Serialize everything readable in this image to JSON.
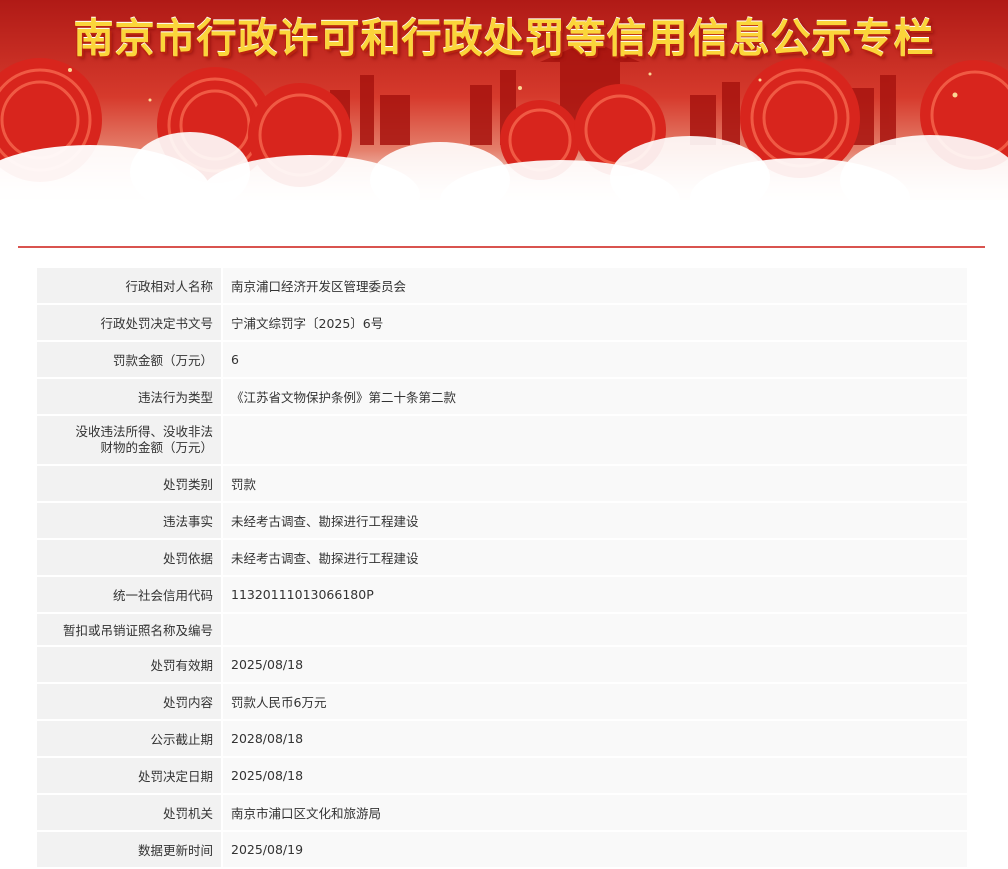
{
  "banner": {
    "title": "南京市行政许可和行政处罚等信用信息公示专栏"
  },
  "colors": {
    "banner_red": "#c8201a",
    "title_gold": "#fbd53a",
    "divider_red": "#d9534f",
    "label_bg": "#f2f2f2",
    "value_bg": "#f9f9f9"
  },
  "record": {
    "rows": [
      {
        "label": "行政相对人名称",
        "value": "南京浦口经济开发区管理委员会"
      },
      {
        "label": "行政处罚决定书文号",
        "value": "宁浦文综罚字〔2025〕6号"
      },
      {
        "label": "罚款金额（万元）",
        "value": "6"
      },
      {
        "label": "违法行为类型",
        "value": "《江苏省文物保护条例》第二十条第二款"
      },
      {
        "label_lines": [
          "没收违法所得、没收非法",
          "财物的金额（万元）"
        ],
        "value": ""
      },
      {
        "label": "处罚类别",
        "value": "罚款"
      },
      {
        "label": "违法事实",
        "value": "未经考古调查、勘探进行工程建设"
      },
      {
        "label": "处罚依据",
        "value": "未经考古调查、勘探进行工程建设"
      },
      {
        "label": "统一社会信用代码",
        "value": "11320111013066180P"
      },
      {
        "label": "暂扣或吊销证照名称及编号",
        "value": ""
      },
      {
        "label": "处罚有效期",
        "value": "2025/08/18"
      },
      {
        "label": "处罚内容",
        "value": "罚款人民币6万元"
      },
      {
        "label": "公示截止期",
        "value": "2028/08/18"
      },
      {
        "label": "处罚决定日期",
        "value": "2025/08/18"
      },
      {
        "label": "处罚机关",
        "value": "南京市浦口区文化和旅游局"
      },
      {
        "label": "数据更新时间",
        "value": "2025/08/19"
      }
    ]
  }
}
